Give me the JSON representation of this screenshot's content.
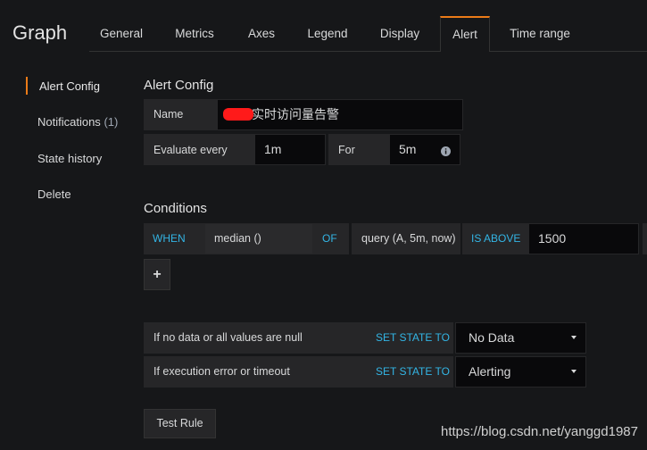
{
  "header": {
    "title": "Graph",
    "tabs": [
      "General",
      "Metrics",
      "Axes",
      "Legend",
      "Display",
      "Alert",
      "Time range"
    ],
    "active_tab": "Alert"
  },
  "sidebar": {
    "items": [
      {
        "label": "Alert Config",
        "active": true
      },
      {
        "label": "Notifications",
        "count": "(1)"
      },
      {
        "label": "State history"
      },
      {
        "label": "Delete"
      }
    ]
  },
  "alert_config": {
    "title": "Alert Config",
    "name_label": "Name",
    "name_value": "实时访问量告警",
    "evaluate_label": "Evaluate every",
    "evaluate_value": "1m",
    "for_label": "For",
    "for_value": "5m"
  },
  "conditions": {
    "title": "Conditions",
    "when": "WHEN",
    "reducer": "median ()",
    "of": "OF",
    "query": "query (A, 5m, now)",
    "evaluator": "IS ABOVE",
    "threshold": "1500",
    "add_label": "+"
  },
  "state_rules": [
    {
      "label": "If no data or all values are null",
      "action": "SET STATE TO",
      "value": "No Data"
    },
    {
      "label": "If execution error or timeout",
      "action": "SET STATE TO",
      "value": "Alerting"
    }
  ],
  "test_rule_label": "Test Rule",
  "watermark": "https://blog.csdn.net/yanggd1987",
  "colors": {
    "accent": "#eb7b18",
    "keyword": "#33b5e5",
    "background": "#161719"
  }
}
